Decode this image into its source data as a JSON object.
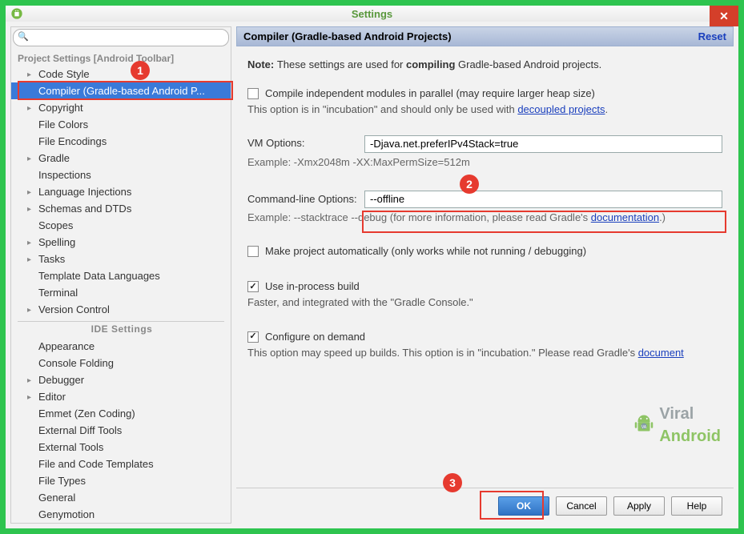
{
  "window": {
    "title": "Settings"
  },
  "sidebar": {
    "section_project": "Project Settings [Android Toolbar]",
    "section_ide": "IDE Settings",
    "items_project": [
      {
        "label": "Code Style",
        "arrow": true
      },
      {
        "label": "Compiler (Gradle-based Android P...",
        "arrow": false,
        "selected": true
      },
      {
        "label": "Copyright",
        "arrow": true
      },
      {
        "label": "File Colors",
        "arrow": false
      },
      {
        "label": "File Encodings",
        "arrow": false
      },
      {
        "label": "Gradle",
        "arrow": true
      },
      {
        "label": "Inspections",
        "arrow": false
      },
      {
        "label": "Language Injections",
        "arrow": true
      },
      {
        "label": "Schemas and DTDs",
        "arrow": true
      },
      {
        "label": "Scopes",
        "arrow": false
      },
      {
        "label": "Spelling",
        "arrow": true
      },
      {
        "label": "Tasks",
        "arrow": true
      },
      {
        "label": "Template Data Languages",
        "arrow": false
      },
      {
        "label": "Terminal",
        "arrow": false
      },
      {
        "label": "Version Control",
        "arrow": true
      }
    ],
    "items_ide": [
      {
        "label": "Appearance",
        "arrow": false
      },
      {
        "label": "Console Folding",
        "arrow": false
      },
      {
        "label": "Debugger",
        "arrow": true
      },
      {
        "label": "Editor",
        "arrow": true
      },
      {
        "label": "Emmet (Zen Coding)",
        "arrow": false
      },
      {
        "label": "External Diff Tools",
        "arrow": false
      },
      {
        "label": "External Tools",
        "arrow": false
      },
      {
        "label": "File and Code Templates",
        "arrow": false
      },
      {
        "label": "File Types",
        "arrow": false
      },
      {
        "label": "General",
        "arrow": false
      },
      {
        "label": "Genymotion",
        "arrow": false
      }
    ]
  },
  "main": {
    "title": "Compiler (Gradle-based Android Projects)",
    "reset": "Reset",
    "note_pre": "Note: ",
    "note_mid1": "These settings are used for ",
    "note_bold": "compiling",
    "note_mid2": " Gradle-based Android projects.",
    "cb_parallel": "Compile independent modules in parallel (may require larger heap size)",
    "parallel_note_pre": "This option is in \"incubation\" and should only be used with ",
    "parallel_link": "decoupled projects",
    "vm_label": "VM Options:",
    "vm_value": "-Djava.net.preferIPv4Stack=true",
    "vm_example": "Example: -Xmx2048m -XX:MaxPermSize=512m",
    "cmd_label": "Command-line Options:",
    "cmd_value": "--offline",
    "cmd_example_pre": "Example: --stacktrace --debug (for more information, please read Gradle's ",
    "cmd_example_link": "documentation",
    "cmd_example_post": ".)",
    "cb_auto": "Make project automatically (only works while not running / debugging)",
    "cb_inproc": "Use in-process build",
    "inproc_note": "Faster, and integrated with the \"Gradle Console.\"",
    "cb_ondemand": "Configure on demand",
    "ondemand_note_pre": "This option may speed up builds. This option is in \"incubation.\" Please read Gradle's ",
    "ondemand_link": "document"
  },
  "footer": {
    "ok": "OK",
    "cancel": "Cancel",
    "apply": "Apply",
    "help": "Help"
  },
  "watermark": {
    "t1": "Viral",
    "t2": "Android"
  },
  "callouts": {
    "c1": "1",
    "c2": "2",
    "c3": "3"
  }
}
